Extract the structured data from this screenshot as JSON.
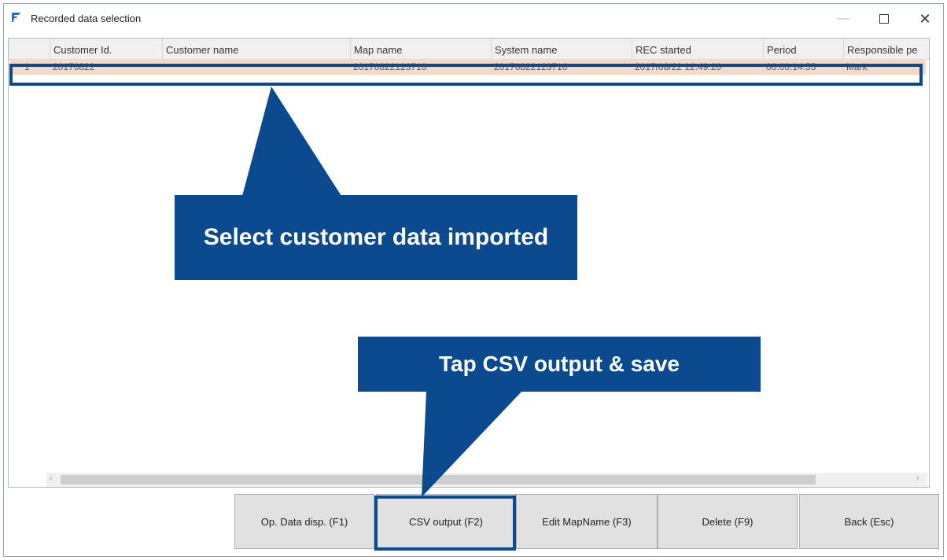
{
  "window": {
    "title": "Recorded data selection",
    "minimize_glyph": "—",
    "close_glyph": "✕"
  },
  "table": {
    "columns": [
      "Customer Id.",
      "Customer name",
      "Map name",
      "System name",
      "REC started",
      "Period",
      "Responsible pe"
    ],
    "rows": [
      {
        "index": "1",
        "cells": [
          "20170822",
          "",
          "20170822123710",
          "20170822123710",
          "2017/08/22 12:49:20",
          "00:00:14:55",
          "Mark"
        ]
      }
    ],
    "scroll_left": "‹",
    "scroll_right": "›"
  },
  "buttons": {
    "op_data": "Op. Data disp. (F1)",
    "csv_output": "CSV output (F2)",
    "edit_mapname": "Edit MapName (F3)",
    "delete": "Delete (F9)",
    "back": "Back (Esc)"
  },
  "callouts": {
    "select": "Select customer data imported",
    "tap": "Tap CSV output & save"
  },
  "colors": {
    "accent": "#0c4a8f",
    "selected_row": "#f6d8c6"
  },
  "icons": {
    "app": "app-flag-icon",
    "minimize": "minimize-icon",
    "maximize": "maximize-icon",
    "close": "close-icon"
  }
}
